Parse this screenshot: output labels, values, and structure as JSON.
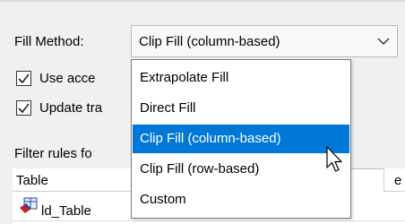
{
  "fill_method": {
    "label": "Fill Method:",
    "selected": "Clip Fill (column-based)",
    "options": [
      "Extrapolate Fill",
      "Direct Fill",
      "Clip Fill (column-based)",
      "Clip Fill (row-based)",
      "Custom"
    ],
    "highlighted_index": 2
  },
  "checkboxes": [
    {
      "label": "Use acce",
      "checked": true
    },
    {
      "label": "Update tra",
      "checked": true
    }
  ],
  "filter_rules_label": "Filter rules fo",
  "table": {
    "columns": [
      "Table",
      "e"
    ],
    "rows": [
      {
        "name": "ld_Table"
      }
    ]
  },
  "colors": {
    "selection": "#0078d7",
    "window_bg": "#f0f0f0"
  },
  "icons": {
    "dropdown": "chevron-down-icon",
    "checkbox": "checkmark-icon",
    "row": "table-icon",
    "cursor": "mouse-pointer-icon"
  }
}
